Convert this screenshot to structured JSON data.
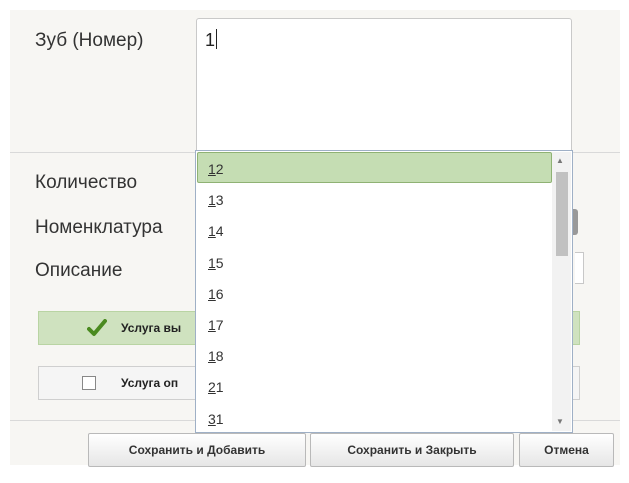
{
  "form": {
    "tooth_label": "Зуб (Номер)",
    "tooth_value": "1",
    "quantity_label": "Количество",
    "nomenclature_label": "Номенклатура",
    "description_label": "Описание"
  },
  "dropdown": {
    "items": [
      {
        "first": "1",
        "rest": "2",
        "selected": true
      },
      {
        "first": "1",
        "rest": "3",
        "selected": false
      },
      {
        "first": "1",
        "rest": "4",
        "selected": false
      },
      {
        "first": "1",
        "rest": "5",
        "selected": false
      },
      {
        "first": "1",
        "rest": "6",
        "selected": false
      },
      {
        "first": "1",
        "rest": "7",
        "selected": false
      },
      {
        "first": "1",
        "rest": "8",
        "selected": false
      },
      {
        "first": "2",
        "rest": "1",
        "selected": false
      },
      {
        "first": "3",
        "rest": "1",
        "selected": false
      }
    ]
  },
  "services": {
    "performed_label": "Услуга вы",
    "optional_label": "Услуга оп"
  },
  "buttons": {
    "save_add": "Сохранить и Добавить",
    "save_close": "Сохранить и Закрыть",
    "cancel": "Отмена"
  },
  "colors": {
    "selected_item": "#c5ddb3",
    "performed_bar": "#cfe2bf",
    "check_icon": "#4a8a1f"
  },
  "icons": {
    "performed": "checkmark-icon",
    "optional": "checkbox-icon"
  }
}
